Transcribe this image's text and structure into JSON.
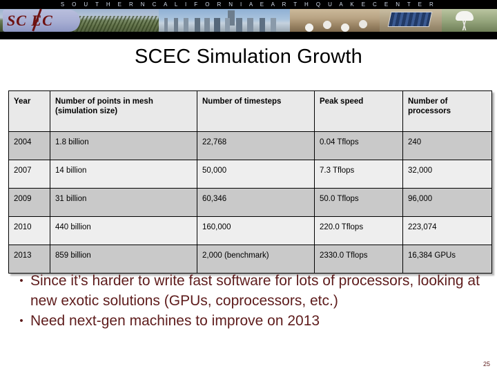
{
  "banner": {
    "strip_text": "S O U T H E R N   C A L I F O R N I A   E A R T H Q U A K E   C E N T E R",
    "logo_text": "SC EC",
    "logo_alt": "scec-logo",
    "photos": [
      "hillside-terrain",
      "los-angeles-skyline",
      "field-researchers",
      "solar-panel-station",
      "gps-dome-antenna"
    ],
    "background_color": "#000000",
    "strip_text_color": "#cfd8e8",
    "logo_color": "#6e1111"
  },
  "slide": {
    "title": "SCEC Simulation Growth",
    "page_number": "25",
    "bullet_color": "#5e1c1c"
  },
  "table": {
    "headers": [
      "Year",
      "Number of points in mesh (simulation size)",
      "Number of timesteps",
      "Peak speed",
      "Number of processors"
    ],
    "rows": [
      {
        "year": "2004",
        "mesh": "1.8 billion",
        "timesteps": "22,768",
        "peak_speed": "0.04 Tflops",
        "processors": "240"
      },
      {
        "year": "2007",
        "mesh": "14 billion",
        "timesteps": "50,000",
        "peak_speed": "7.3 Tflops",
        "processors": "32,000"
      },
      {
        "year": "2009",
        "mesh": "31 billion",
        "timesteps": "60,346",
        "peak_speed": "50.0 Tflops",
        "processors": "96,000"
      },
      {
        "year": "2010",
        "mesh": "440 billion",
        "timesteps": "160,000",
        "peak_speed": "220.0 Tflops",
        "processors": "223,074"
      },
      {
        "year": "2013",
        "mesh": "859 billion",
        "timesteps": "2,000 (benchmark)",
        "peak_speed": "2330.0 Tflops",
        "processors": "16,384 GPUs"
      }
    ],
    "header_background": "#e9e9e9",
    "row_dark_background": "#c9c9c9",
    "row_light_background": "#eeeeee"
  },
  "bullets": [
    {
      "marker": "•",
      "text": "Since it’s harder to write fast software for lots of processors, looking at new exotic solutions (GPUs, coprocessors, etc.)"
    },
    {
      "marker": "•",
      "text": "Need next-gen machines to improve on 2013"
    }
  ]
}
